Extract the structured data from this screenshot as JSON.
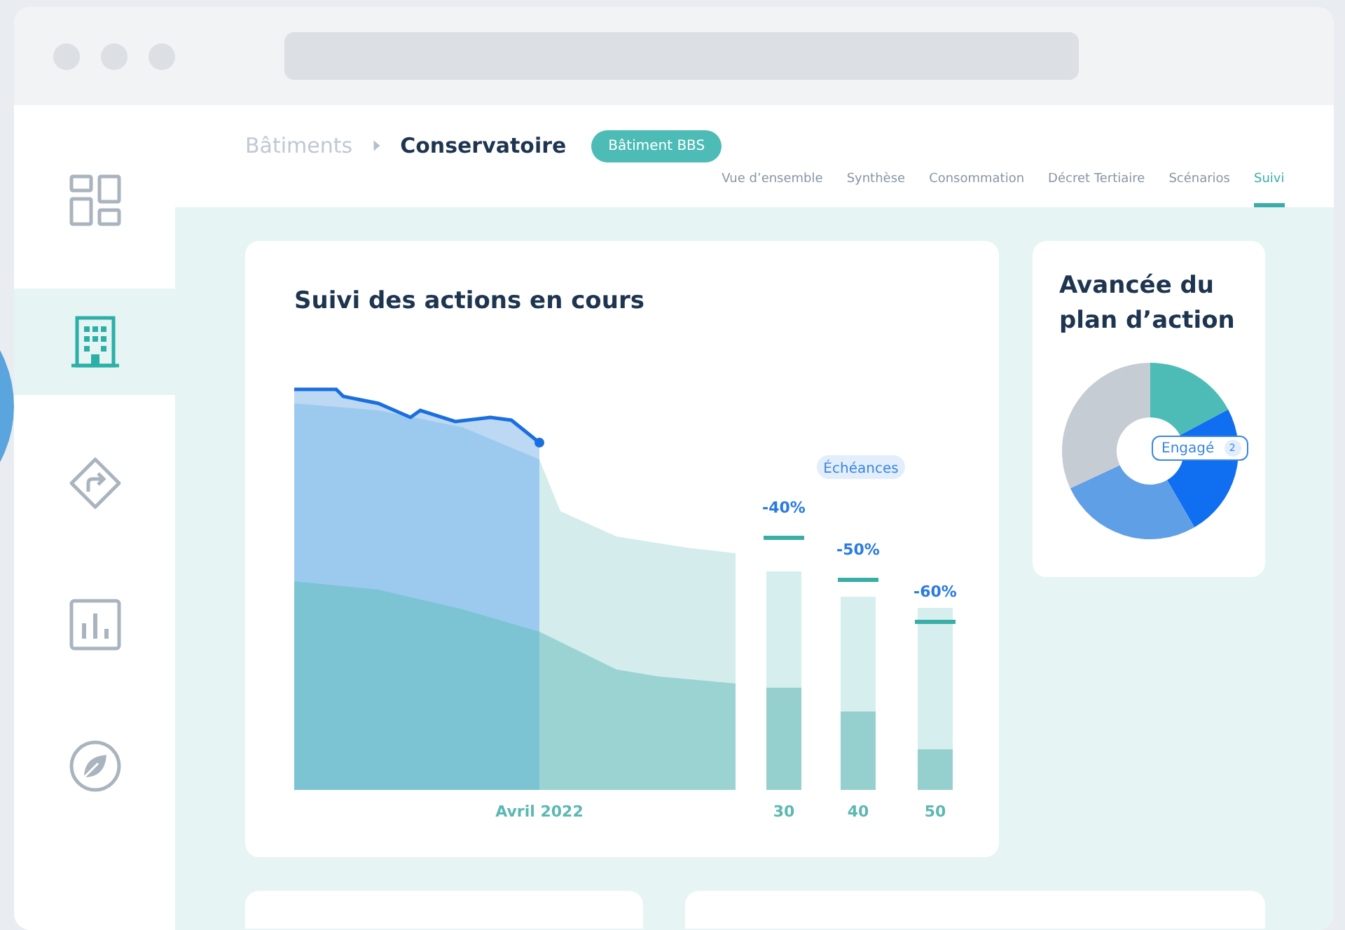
{
  "browser": {
    "address_bar": {
      "kind": "empty"
    }
  },
  "sidebar": {
    "items": [
      {
        "selected": false
      },
      {
        "selected": true
      },
      {
        "selected": false
      },
      {
        "selected": false
      },
      {
        "selected": false
      }
    ]
  },
  "header": {
    "breadcrumb": [
      "Bâtiments",
      "Conservatoire"
    ],
    "badge": "Bâtiment BBS",
    "tabs": [
      {
        "label": "Vue d’ensemble",
        "selected": false
      },
      {
        "label": "Synthèse",
        "selected": false
      },
      {
        "label": "Consommation",
        "selected": false
      },
      {
        "label": "Décret Tertiaire",
        "selected": false
      },
      {
        "label": "Scénarios",
        "selected": false
      },
      {
        "label": "Suivi",
        "selected": true
      }
    ]
  },
  "actions_card": {
    "title": "Suivi des actions en cours",
    "date_label": "Avril 2022",
    "deadlines_label": "Échéances",
    "targets": [
      {
        "reduction": "-40%",
        "year": "30"
      },
      {
        "reduction": "-50%",
        "year": "40"
      },
      {
        "reduction": "-60%",
        "year": "50"
      }
    ]
  },
  "plan_card": {
    "title": "Avancée du plan d’action",
    "legend": {
      "label": "Engagé",
      "count": "2"
    }
  }
}
